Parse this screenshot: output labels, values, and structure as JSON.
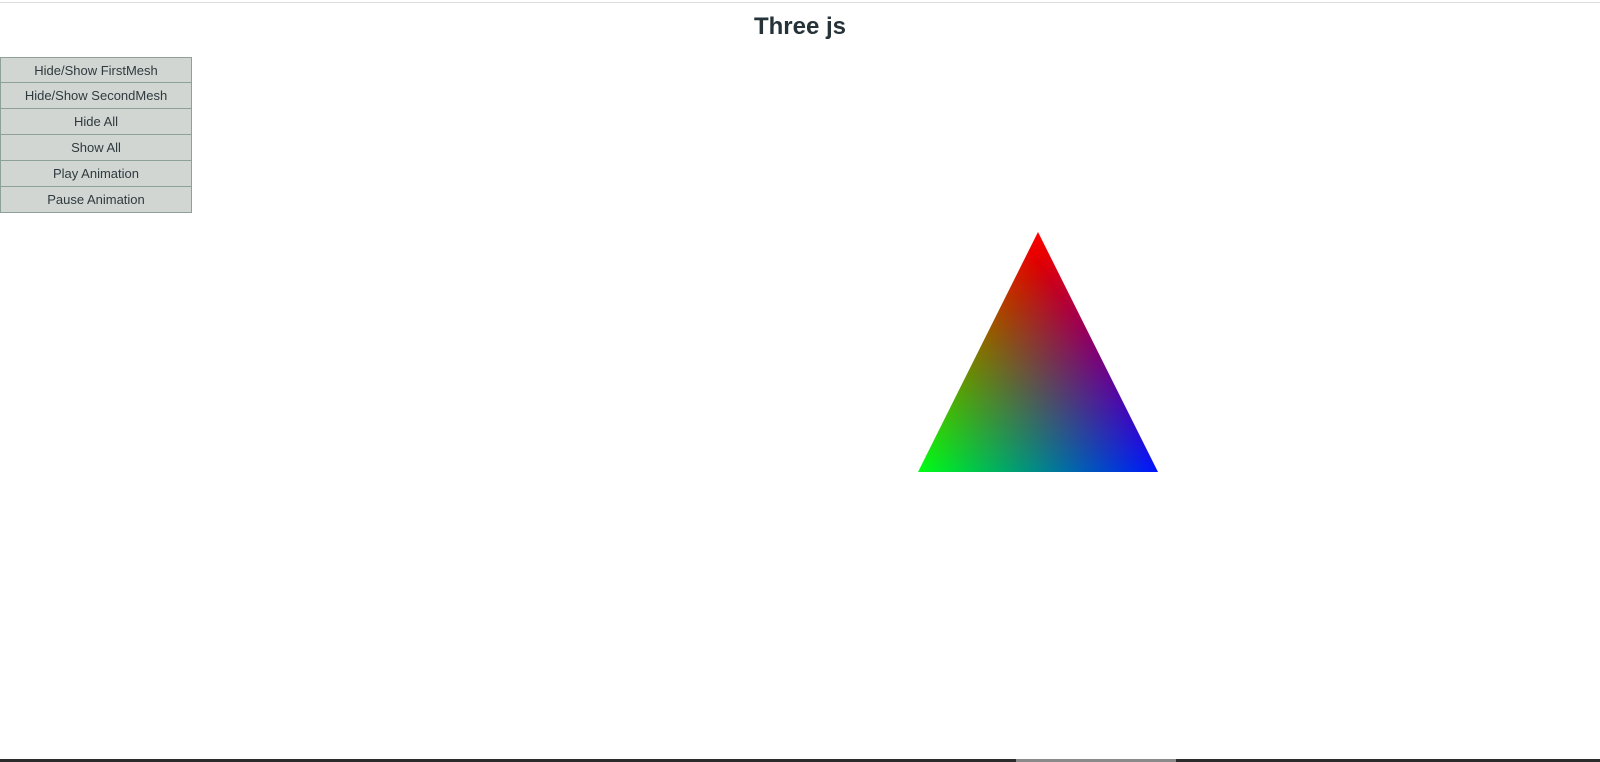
{
  "page": {
    "title": "Three js"
  },
  "controls": {
    "buttons": [
      {
        "label": "Hide/Show FirstMesh"
      },
      {
        "label": "Hide/Show SecondMesh"
      },
      {
        "label": "Hide All"
      },
      {
        "label": "Show All"
      },
      {
        "label": "Play Animation"
      },
      {
        "label": "Pause Animation"
      }
    ]
  },
  "scene": {
    "mesh": {
      "shape": "triangle",
      "vertex_colors": {
        "top": "#ff0000",
        "bottom_left": "#00ff00",
        "bottom_right": "#0000ff"
      }
    }
  },
  "colors": {
    "title_text": "#253238",
    "button_bg": "#d2d6d2",
    "button_border": "#8da196",
    "button_text": "#2e3a3f"
  }
}
